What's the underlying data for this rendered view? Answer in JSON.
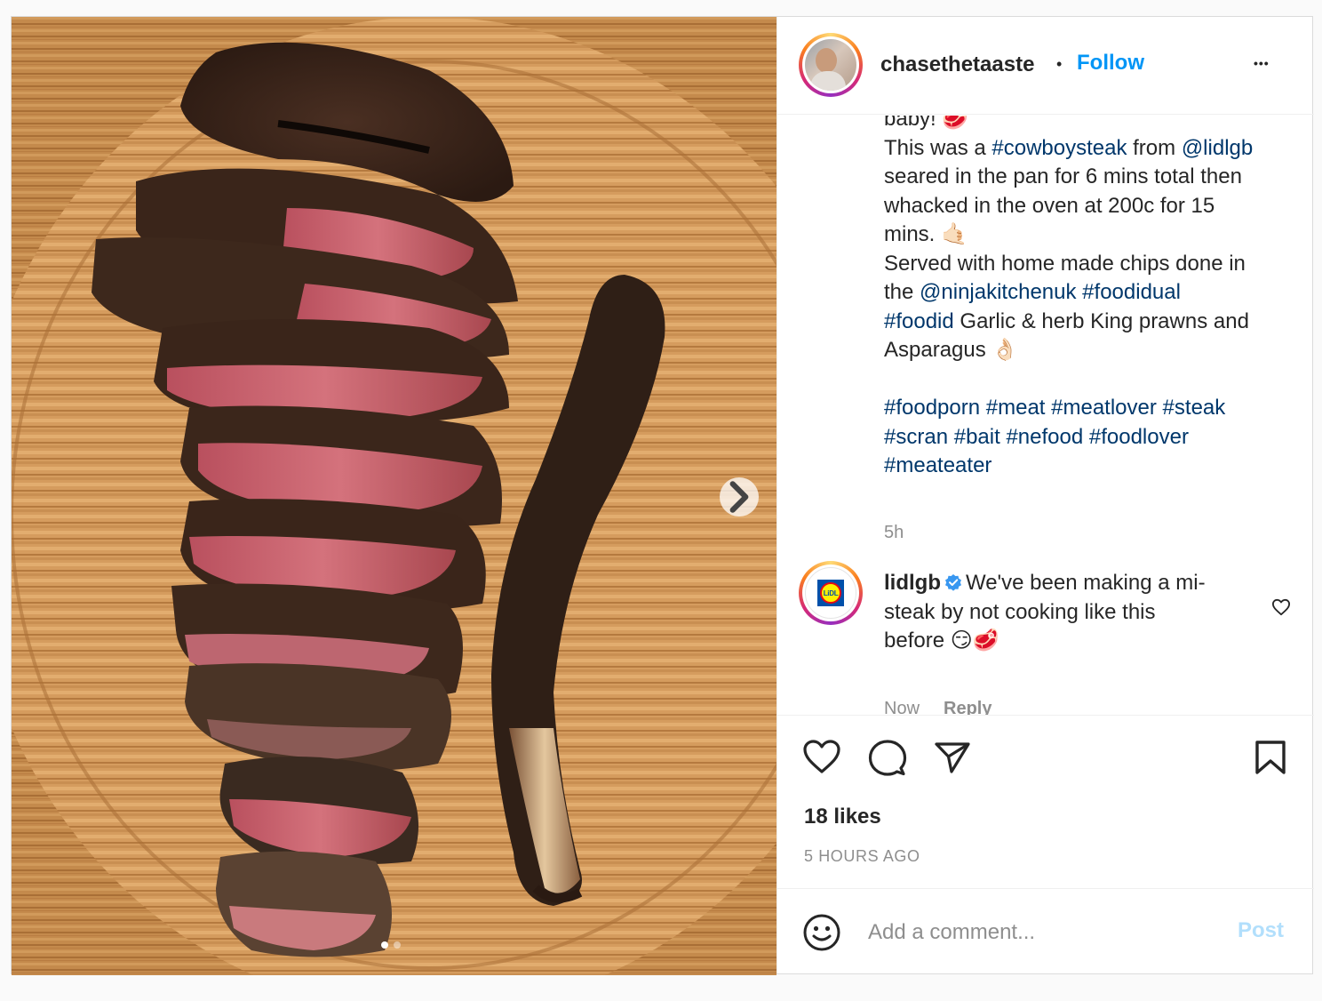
{
  "post": {
    "username": "chasethetaaste",
    "follow_label": "Follow",
    "separator": "•",
    "more_label": "•••"
  },
  "caption": {
    "line_0": "baby! 🥩",
    "line_1_a": "This was a ",
    "line_1_tag": "#cowboysteak",
    "line_1_b": " from ",
    "line_1_mention": "@lidlgb",
    "line_2": "seared in the pan for 6 mins total then",
    "line_3": "whacked in the oven at 200c for 15",
    "line_4": "mins. 🤙🏻",
    "line_5": "Served with home made chips done in",
    "line_6_a": "the ",
    "line_6_mention": "@ninjakitchenuk",
    "line_6_tag": "#foodidual",
    "line_7_tag": "#foodid",
    "line_7_b": " Garlic & herb King prawns and",
    "line_8": "Asparagus 👌🏻",
    "hashtags_line_1": [
      "#foodporn",
      "#meat",
      "#meatlover",
      "#steak"
    ],
    "hashtags_line_2": [
      "#scran",
      "#bait",
      "#nefood",
      "#foodlover"
    ],
    "hashtags_line_3": [
      "#meateater"
    ],
    "time": "5h"
  },
  "comment": {
    "username": "lidlgb",
    "logo_text": "LiDL",
    "text_1": "We've been making a mi-",
    "text_2": "steak by not cooking like this",
    "text_3": "before 😏🥩",
    "time": "Now",
    "reply_label": "Reply"
  },
  "actions": {
    "likes": "18 likes",
    "posted_ago": "5 HOURS AGO"
  },
  "add_comment": {
    "placeholder": "Add a comment...",
    "post_label": "Post"
  },
  "carousel": {
    "current_slide": 1,
    "total_slides": 2
  },
  "colors": {
    "accent": "#0095f6",
    "link": "#00376b",
    "muted": "#8e8e8e",
    "post_disabled": "#b2dffc",
    "verified": "#3897f0"
  }
}
